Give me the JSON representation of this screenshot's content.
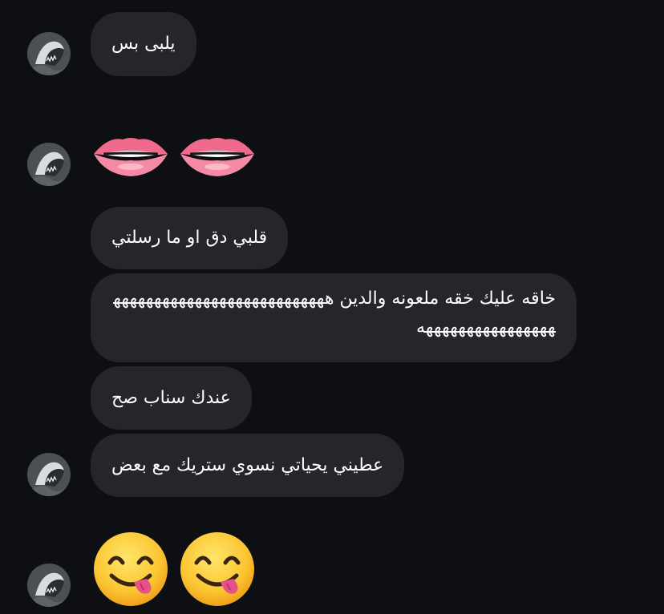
{
  "colors": {
    "background": "#0e0f13",
    "bubble": "#25262b",
    "text": "#ffffff"
  },
  "avatar": {
    "icon": "shark-avatar-icon"
  },
  "messages": [
    {
      "type": "text",
      "text": "يلبى بس"
    },
    {
      "type": "emoji",
      "icon": "lips-icon",
      "count": 2
    },
    {
      "type": "text",
      "text": "قلبي دق او ما رسلتي"
    },
    {
      "type": "text",
      "text": "خاقه عليك خقه ملعونه والدين هههههههههههههههههههههههههههههههههههههههههههه"
    },
    {
      "type": "text",
      "text": "عندك سناب صح"
    },
    {
      "type": "text",
      "text": "عطيني يحياتي نسوي ستريك مع بعض"
    },
    {
      "type": "emoji",
      "icon": "face-savoring-food-icon",
      "count": 2
    }
  ]
}
